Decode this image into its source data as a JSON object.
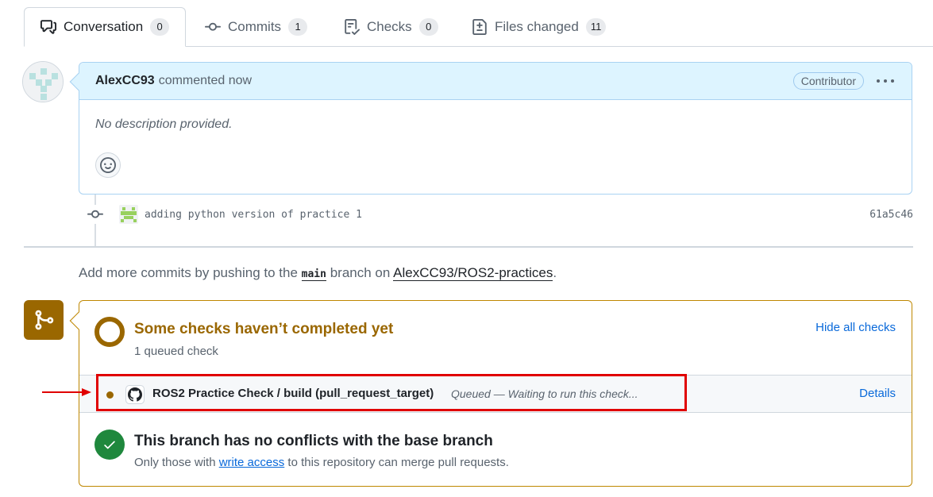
{
  "tabs": [
    {
      "label": "Conversation",
      "count": "0",
      "icon": "comment-discussion-icon"
    },
    {
      "label": "Commits",
      "count": "1",
      "icon": "git-commit-icon"
    },
    {
      "label": "Checks",
      "count": "0",
      "icon": "checklist-icon"
    },
    {
      "label": "Files changed",
      "count": "11",
      "icon": "file-diff-icon"
    }
  ],
  "comment": {
    "author": "AlexCC93",
    "action": "commented now",
    "role_badge": "Contributor",
    "body": "No description provided."
  },
  "commit": {
    "message": "adding python version of practice 1",
    "sha": "61a5c46"
  },
  "push_hint": {
    "prefix": "Add more commits by pushing to the",
    "branch": "main",
    "middle": "branch on",
    "repo": "AlexCC93/ROS2-practices",
    "suffix": "."
  },
  "checks": {
    "title": "Some checks haven’t completed yet",
    "subtitle": "1 queued check",
    "hide_label": "Hide all checks",
    "items": [
      {
        "name": "ROS2 Practice Check / build (pull_request_target)",
        "status": "Queued — Waiting to run this check...",
        "details_label": "Details"
      }
    ]
  },
  "merge": {
    "title": "This branch has no conflicts with the base branch",
    "sub_prefix": "Only those with",
    "sub_link": "write access",
    "sub_suffix": "to this repository can merge pull requests."
  },
  "colors": {
    "pending": "#9a6700",
    "success": "#1f883d",
    "link": "#0969da",
    "annotation": "#e00000"
  }
}
